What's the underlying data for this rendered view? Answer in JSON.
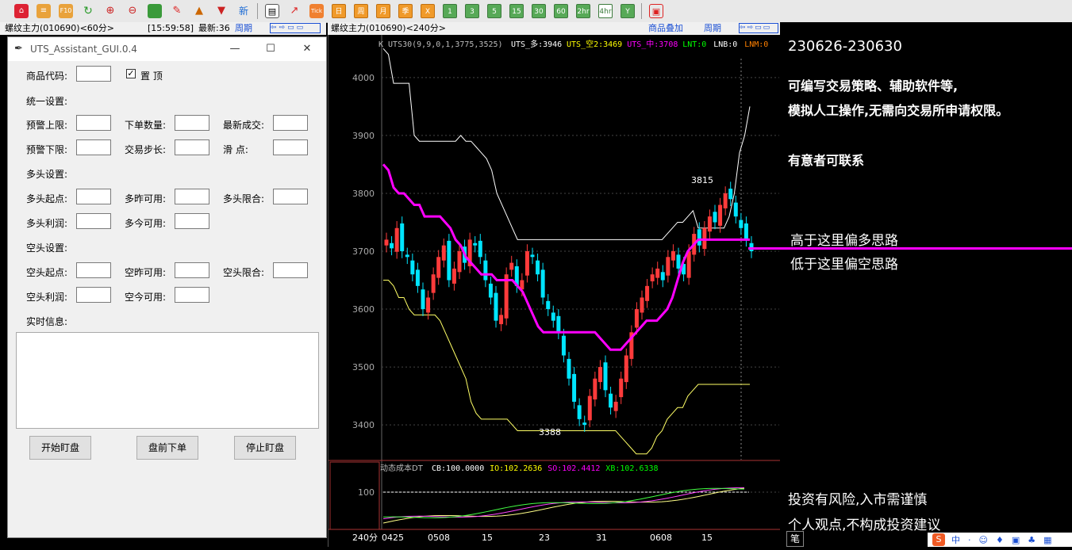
{
  "toolbar": {
    "icons": [
      "home-icon",
      "database-icon",
      "f10-icon",
      "refresh-icon",
      "zoom-in-icon",
      "zoom-out-icon",
      "window-icon",
      "pen-icon",
      "hat-icon",
      "filter-icon"
    ],
    "new_label": "新",
    "tick_label": "Tick",
    "periods": [
      "日",
      "周",
      "月",
      "季",
      "X",
      "1",
      "3",
      "5",
      "15",
      "30",
      "60",
      "2hr",
      "4hr",
      "Y"
    ]
  },
  "left_title": {
    "text": "螺纹主力(010690)<60分>",
    "time": "[15:59:58]",
    "latest": "最新:36",
    "period": "周期"
  },
  "mid_title": {
    "text": "螺纹主力(010690)<240分>",
    "overlay": "商品叠加",
    "period": "周期"
  },
  "dialog": {
    "title": "UTS_Assistant_GUI.0.4",
    "code_label": "商品代码:",
    "top_label": "置 顶",
    "top_checked": true,
    "unified": "统一设置:",
    "warn_up": "预警上限:",
    "order_qty": "下单数量:",
    "last_trade": "最新成交:",
    "warn_down": "预警下限:",
    "step": "交易步长:",
    "slip": "滑      点:",
    "long_settings": "多头设置:",
    "long_start": "多头起点:",
    "long_yday": "多昨可用:",
    "long_limit": "多头限合:",
    "long_profit": "多头利润:",
    "long_today": "多今可用:",
    "short_settings": "空头设置:",
    "short_start": "空头起点:",
    "short_yday": "空昨可用:",
    "short_limit": "空头限合:",
    "short_profit": "空头利润:",
    "short_today": "空今可用:",
    "realtime": "实时信息:",
    "btn_start": "开始盯盘",
    "btn_preorder": "盘前下单",
    "btn_stop": "停止盯盘"
  },
  "chart_data": {
    "type": "candlestick",
    "title": "",
    "indicator_line": "K  UTS30(9,9,0,1,3775,3525)",
    "legend": [
      {
        "label": "UTS_多:3946",
        "color": "#ffffff"
      },
      {
        "label": "UTS_空2:3469",
        "color": "#ffff00"
      },
      {
        "label": "UTS_中:3708",
        "color": "#ff00ff"
      },
      {
        "label": "LNT:0",
        "color": "#00ff00"
      },
      {
        "label": "LNB:0",
        "color": "#ffffff"
      },
      {
        "label": "LNM:0",
        "color": "#ff8000"
      }
    ],
    "y_ticks": [
      4000,
      3900,
      3800,
      3700,
      3600,
      3500,
      3400
    ],
    "ylim": [
      3340,
      4060
    ],
    "annot_high": "3815",
    "annot_low": "3388",
    "x_labels": [
      "0425",
      "0508",
      "15",
      "23",
      "31",
      "0608",
      "15"
    ],
    "candle_close": [
      3720,
      3705,
      3740,
      3700,
      3690,
      3660,
      3640,
      3600,
      3620,
      3660,
      3690,
      3710,
      3650,
      3670,
      3700,
      3680,
      3720,
      3710,
      3690,
      3650,
      3620,
      3580,
      3590,
      3660,
      3680,
      3640,
      3650,
      3700,
      3690,
      3660,
      3620,
      3600,
      3580,
      3560,
      3520,
      3480,
      3440,
      3410,
      3400,
      3450,
      3480,
      3500,
      3460,
      3430,
      3440,
      3480,
      3520,
      3560,
      3600,
      3620,
      3640,
      3660,
      3670,
      3650,
      3690,
      3700,
      3670,
      3660,
      3700,
      3730,
      3710,
      3740,
      3760,
      3750,
      3780,
      3800,
      3790,
      3760,
      3740,
      3720,
      3700
    ],
    "uts_multi": [
      4050,
      4040,
      3990,
      3990,
      3990,
      3990,
      3900,
      3890,
      3890,
      3890,
      3890,
      3890,
      3890,
      3890,
      3890,
      3900,
      3890,
      3890,
      3880,
      3870,
      3860,
      3840,
      3800,
      3780,
      3760,
      3740,
      3720,
      3720,
      3720,
      3720,
      3720,
      3720,
      3720,
      3720,
      3720,
      3720,
      3720,
      3720,
      3720,
      3720,
      3720,
      3720,
      3720,
      3720,
      3720,
      3720,
      3720,
      3720,
      3720,
      3720,
      3720,
      3720,
      3720,
      3720,
      3720,
      3730,
      3740,
      3750,
      3750,
      3760,
      3770,
      3740,
      3740,
      3740,
      3740,
      3740,
      3740,
      3760,
      3800,
      3870,
      3900,
      3950
    ],
    "uts_short": [
      3650,
      3650,
      3640,
      3620,
      3620,
      3600,
      3590,
      3590,
      3590,
      3590,
      3590,
      3580,
      3560,
      3540,
      3520,
      3500,
      3480,
      3440,
      3420,
      3410,
      3410,
      3410,
      3410,
      3410,
      3410,
      3400,
      3390,
      3390,
      3390,
      3390,
      3390,
      3390,
      3390,
      3390,
      3390,
      3390,
      3390,
      3390,
      3390,
      3390,
      3390,
      3390,
      3390,
      3390,
      3390,
      3390,
      3380,
      3370,
      3360,
      3350,
      3350,
      3350,
      3360,
      3380,
      3390,
      3410,
      3420,
      3430,
      3430,
      3450,
      3460,
      3470,
      3470,
      3470,
      3470,
      3470,
      3470,
      3470,
      3470,
      3470,
      3470,
      3470
    ],
    "uts_mid": [
      3850,
      3840,
      3810,
      3800,
      3800,
      3790,
      3780,
      3780,
      3760,
      3760,
      3760,
      3760,
      3750,
      3740,
      3720,
      3710,
      3690,
      3680,
      3670,
      3660,
      3660,
      3660,
      3650,
      3650,
      3650,
      3650,
      3640,
      3630,
      3610,
      3590,
      3570,
      3560,
      3560,
      3560,
      3560,
      3560,
      3560,
      3560,
      3560,
      3560,
      3560,
      3560,
      3550,
      3540,
      3530,
      3530,
      3530,
      3540,
      3550,
      3560,
      3570,
      3580,
      3580,
      3580,
      3590,
      3600,
      3620,
      3650,
      3680,
      3700,
      3710,
      3720,
      3720,
      3720,
      3720,
      3720,
      3720,
      3720,
      3720,
      3720,
      3720,
      3720
    ],
    "sub_indicator": "动态成本DT",
    "sub_legend": [
      {
        "label": "CB:100.0000",
        "color": "#ffffff"
      },
      {
        "label": "IO:102.2636",
        "color": "#ffff00"
      },
      {
        "label": "SO:102.4412",
        "color": "#ff00ff"
      },
      {
        "label": "XB:102.6338",
        "color": "#00ff00"
      }
    ],
    "sub_y_tick": "100",
    "period_label": "240分"
  },
  "right_panel": {
    "date_range": "230626-230630",
    "line1": "可编写交易策略、辅助软件等,",
    "line2": "模拟人工操作,无需向交易所申请权限。",
    "line3": "有意者可联系",
    "above": "高于这里偏多思路",
    "below": "低于这里偏空思路",
    "risk": "投资有风险,入市需谨慎",
    "opinion": "个人观点,不构成投资建议",
    "bi": "笔"
  },
  "colors": {
    "up": "#ff3b3b",
    "down": "#00e5ff",
    "multi": "#ffffff",
    "short": "#ffff66",
    "mid": "#ff00ff",
    "guide": "#ff00ff"
  }
}
